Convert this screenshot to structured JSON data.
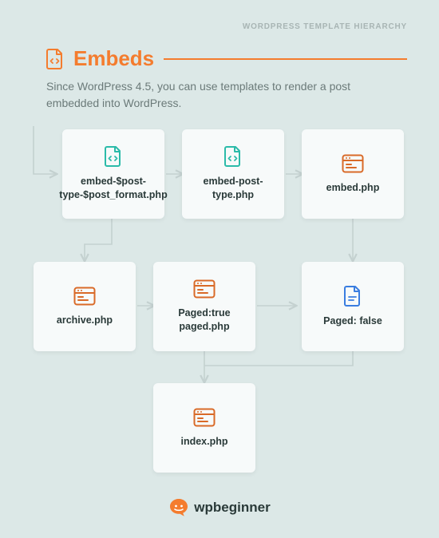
{
  "header": {
    "eyebrow": "WORDPRESS TEMPLATE HIERARCHY"
  },
  "title": {
    "text": "Embeds",
    "icon": "file-code-icon"
  },
  "description": "Since WordPress 4.5, you can use templates to render a post embedded into WordPress.",
  "nodes": {
    "n1": {
      "label": "embed-$post-type-$post_format.php",
      "icon": "file-code-icon",
      "iconColor": "teal"
    },
    "n2": {
      "label": "embed-post-type.php",
      "icon": "file-code-icon",
      "iconColor": "teal"
    },
    "n3": {
      "label": "embed.php",
      "icon": "browser-icon",
      "iconColor": "orange"
    },
    "n4": {
      "label": "archive.php",
      "icon": "browser-icon",
      "iconColor": "orange"
    },
    "n5": {
      "label": "Paged:true paged.php",
      "icon": "browser-icon",
      "iconColor": "orange"
    },
    "n6": {
      "label": "Paged: false",
      "icon": "file-icon",
      "iconColor": "blue"
    },
    "n7": {
      "label": "index.php",
      "icon": "browser-icon",
      "iconColor": "orange"
    }
  },
  "footer": {
    "text": "wpbeginner"
  },
  "colors": {
    "orange": "#f47c2e",
    "teal": "#2bbba9",
    "blue": "#3a7de0",
    "arrow": "#c4d1d0",
    "bg": "#dce8e7"
  }
}
